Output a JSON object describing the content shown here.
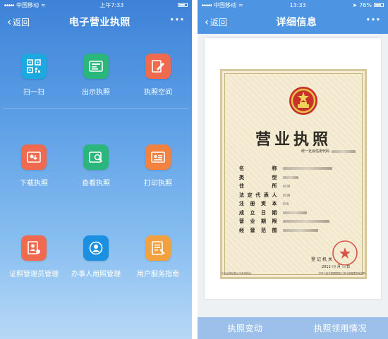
{
  "left_phone": {
    "status": {
      "carrier": "中国移动",
      "time": "上午7:33"
    },
    "nav": {
      "back_label": "返回",
      "title": "电子营业执照",
      "more": "···"
    },
    "tiles": [
      {
        "label": "扫一扫",
        "icon": "qr-scan-icon",
        "color": "#1ba9e0"
      },
      {
        "label": "出示执照",
        "icon": "license-card-icon",
        "color": "#2bb67c"
      },
      {
        "label": "执照空间",
        "icon": "license-space-icon",
        "color": "#f06a4f"
      },
      {
        "label": "下载执照",
        "icon": "download-license-icon",
        "color": "#f06a4f"
      },
      {
        "label": "查看执照",
        "icon": "view-license-icon",
        "color": "#2bb67c"
      },
      {
        "label": "打印执照",
        "icon": "print-license-icon",
        "color": "#f3813f"
      },
      {
        "label": "证照管理员管理",
        "icon": "admin-manage-icon",
        "color": "#f06a4f"
      },
      {
        "label": "办事人用照管理",
        "icon": "agent-manage-icon",
        "color": "#1b8fe0"
      },
      {
        "label": "用户服务指南",
        "icon": "user-guide-icon",
        "color": "#f3a03f"
      }
    ]
  },
  "right_phone": {
    "status": {
      "carrier": "中国移动",
      "time": "13:33",
      "battery": "76%"
    },
    "nav": {
      "back_label": "返回",
      "title": "详细信息",
      "more": "···"
    },
    "certificate": {
      "title": "营业执照",
      "code_label": "统一社会信用代码",
      "fields": [
        "名称",
        "类型",
        "住所",
        "法定代表人",
        "注册资本",
        "成立日期",
        "营业期限",
        "经营范围"
      ],
      "issuer": "登记机关",
      "issue_year": "2011",
      "issue_month": "月",
      "issue_day": "日",
      "footer_left": "企业信用信息公示系统网址：",
      "footer_right": "中华人民共和国国家工商行政管理总局监制"
    },
    "actions": {
      "change": "执照变动",
      "usage": "执照领用情况"
    }
  },
  "colors": {
    "left_bg_top": "#3d82d8",
    "right_nav": "#4d95e2",
    "bottom_bar": "#9cc0ea",
    "cert_paper": "#f5ecd4"
  }
}
